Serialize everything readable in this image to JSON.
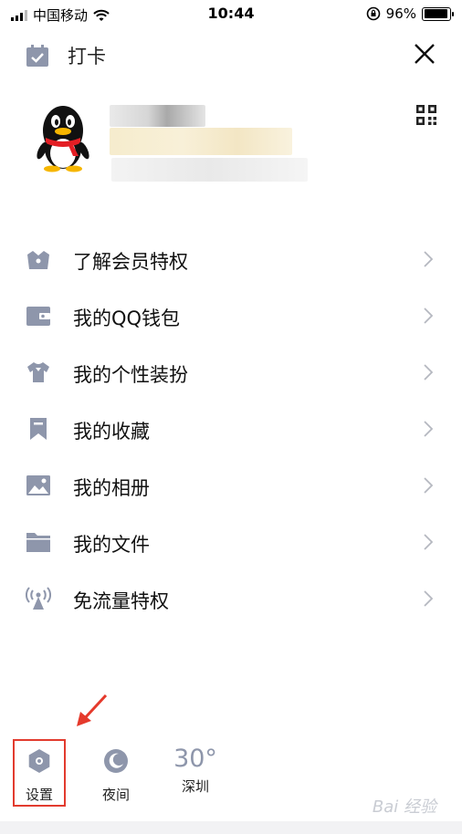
{
  "status_bar": {
    "carrier": "中国移动",
    "time": "10:44",
    "battery": "96%",
    "battery_level": 0.96,
    "icons": [
      "signal-icon",
      "wifi-icon",
      "rotation-lock-icon",
      "battery-icon"
    ]
  },
  "header": {
    "checkin_label": "打卡",
    "checkin_icon": "calendar-check-icon",
    "close_icon": "close-icon"
  },
  "profile": {
    "avatar_icon": "qq-penguin-avatar",
    "qr_icon": "qr-code-icon",
    "nickname_redacted": true
  },
  "menu": {
    "items": [
      {
        "label": "了解会员特权",
        "icon": "vip-crown-icon"
      },
      {
        "label": "我的QQ钱包",
        "icon": "wallet-icon"
      },
      {
        "label": "我的个性装扮",
        "icon": "tshirt-icon"
      },
      {
        "label": "我的收藏",
        "icon": "bookmark-icon"
      },
      {
        "label": "我的相册",
        "icon": "photo-album-icon"
      },
      {
        "label": "我的文件",
        "icon": "folder-icon"
      },
      {
        "label": "免流量特权",
        "icon": "signal-tower-icon"
      }
    ]
  },
  "bottom": {
    "settings_label": "设置",
    "night_label": "夜间",
    "weather_temp": "30°",
    "weather_city": "深圳"
  },
  "watermark": "Bai 经验",
  "colors": {
    "icon_gray": "#8e96ab",
    "highlight_red": "#e23b2e",
    "arrow_red": "#e53a2c"
  }
}
